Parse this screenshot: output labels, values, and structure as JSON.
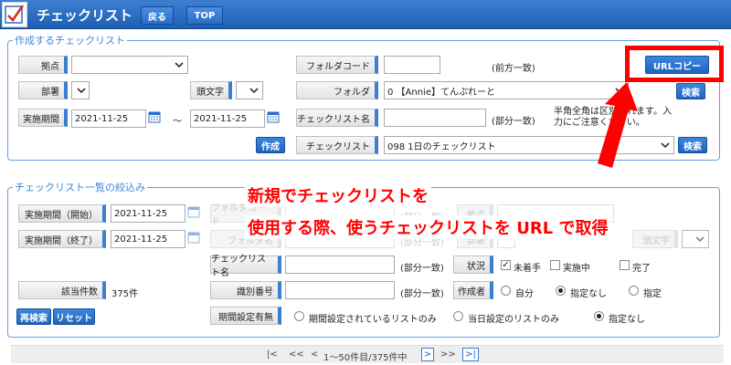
{
  "header": {
    "title": "チェックリスト",
    "back_label": "戻る",
    "top_label": "TOP"
  },
  "create": {
    "legend": "作成するチェックリスト",
    "kyoten_label": "拠点",
    "busho_label": "部署",
    "kashira_label": "頭文字",
    "period_label": "実施期間",
    "date_from": "2021-11-25",
    "tilde": "〜",
    "date_to": "2021-11-25",
    "create_label": "作成",
    "folder_code_label": "フォルダコード",
    "folder_code_hint": "(前方一致)",
    "folder_label": "フォルダ",
    "folder_value": "0 【Annie】てんぷれーと",
    "search_label": "検索",
    "checklist_name_label": "チェックリスト名",
    "partial_hint": "(部分一致)",
    "note": "半角全角は区別されます。入力にご注意ください。",
    "checklist_label": "チェックリスト",
    "checklist_value": "098 1日のチェックリスト",
    "url_copy_label": "URLコピー"
  },
  "filter": {
    "legend": "チェックリスト一覧の絞込み",
    "start_label": "実施期間（開始）",
    "start_value": "2021-11-25",
    "end_label": "実施期間（終了）",
    "end_value": "2021-11-25",
    "folder_code_label": "フォルダコード",
    "folder_name_label": "フォルダ名",
    "partial_hint": "(部分一致)",
    "kyoten_label": "拠点",
    "busho_label": "部署",
    "kashira_label": "頭文字",
    "count_label": "該当件数",
    "count_value": "375件",
    "checklist_name_label": "チェックリスト名",
    "id_label": "識別番号",
    "period_setting_label": "期間設定有無",
    "status_label": "状況",
    "status_options": [
      "未着手",
      "実施中",
      "完了"
    ],
    "author_label": "作成者",
    "author_options": [
      "自分",
      "指定なし",
      "指定"
    ],
    "period_options": [
      "期間設定されているリストのみ",
      "当日設定のリストのみ",
      "指定なし"
    ],
    "research_label": "再検索",
    "reset_label": "リセット"
  },
  "annotation": {
    "line1": "新規でチェックリストを",
    "line2": "使用する際、使うチェックリストを URL で取得"
  },
  "pager": {
    "first": "|<",
    "prev2": "<<",
    "prev": "<",
    "range": "1〜50件目/375件中",
    "next": ">",
    "next2": ">>",
    "last": ">|"
  },
  "colors": {
    "accent": "#3b7fd0",
    "annotation": "#ff0000"
  }
}
